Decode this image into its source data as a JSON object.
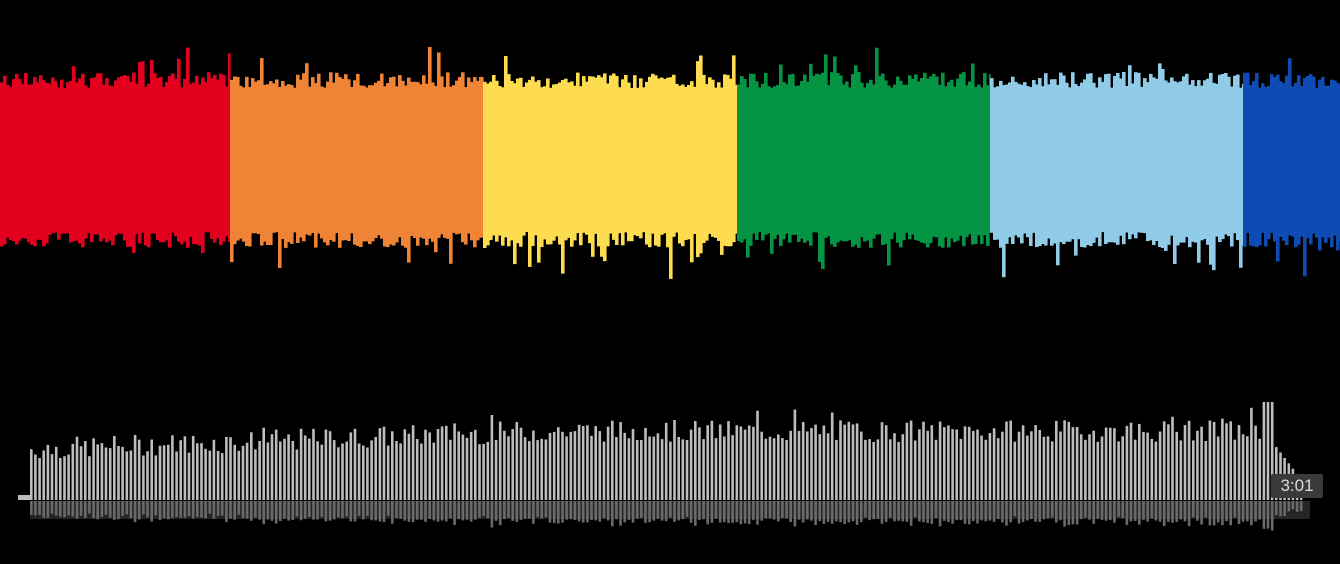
{
  "zoomed_waveform": {
    "segments": [
      {
        "name": "red",
        "color": "#e3001f"
      },
      {
        "name": "orange",
        "color": "#f08436"
      },
      {
        "name": "yellow",
        "color": "#fddc4f"
      },
      {
        "name": "green",
        "color": "#049444"
      },
      {
        "name": "light-blue",
        "color": "#90cbe8"
      },
      {
        "name": "blue",
        "color": "#0f4bb4"
      }
    ],
    "background": "#000000"
  },
  "overview_waveform": {
    "bar_color_top": "#bdbdbd",
    "bar_color_bottom": "#6a6a6a",
    "duration": "3:01"
  }
}
